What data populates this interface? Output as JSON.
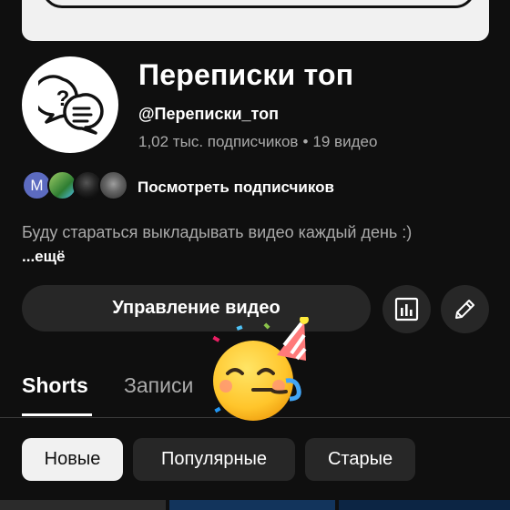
{
  "channel": {
    "name": "Переписки топ",
    "handle": "@Переписки_топ",
    "subscribers": "1,02 тыс. подписчиков",
    "separator": "•",
    "videos": "19 видео",
    "description": "Буду стараться выкладывать видео каждый день :)",
    "more_label": "...ещё"
  },
  "subscribers_preview": {
    "first_initial": "М",
    "link_label": "Посмотреть подписчиков"
  },
  "actions": {
    "manage_label": "Управление видео",
    "stats_icon": "bar-chart-icon",
    "edit_icon": "pencil-icon"
  },
  "tabs": [
    {
      "label": "Shorts",
      "active": true
    },
    {
      "label": "Записи",
      "active": false
    }
  ],
  "filters": [
    {
      "label": "Новые",
      "selected": true
    },
    {
      "label": "Популярные",
      "selected": false
    },
    {
      "label": "Старые",
      "selected": false
    }
  ],
  "colors": {
    "background": "#0f0f0f",
    "chip": "#272727",
    "selected_chip": "#f1f1f1",
    "secondary_text": "#aaaaaa"
  }
}
